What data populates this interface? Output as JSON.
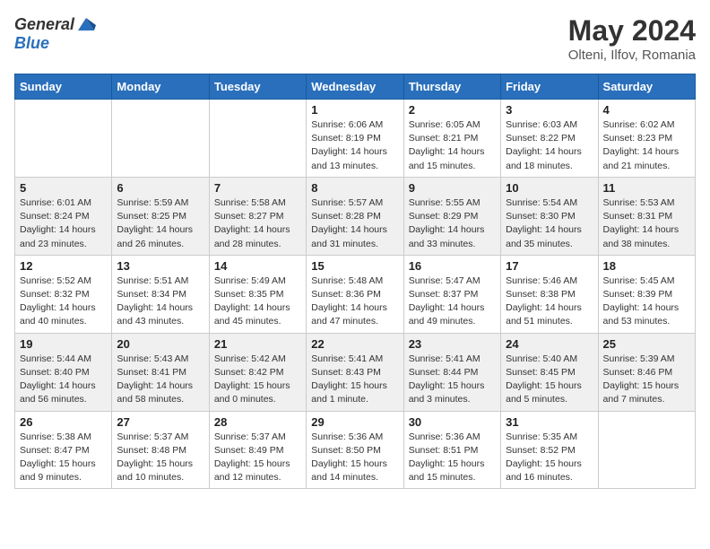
{
  "header": {
    "logo_general": "General",
    "logo_blue": "Blue",
    "month_title": "May 2024",
    "location": "Olteni, Ilfov, Romania"
  },
  "days_of_week": [
    "Sunday",
    "Monday",
    "Tuesday",
    "Wednesday",
    "Thursday",
    "Friday",
    "Saturday"
  ],
  "weeks": [
    {
      "row_shade": false,
      "days": [
        {
          "num": "",
          "info": ""
        },
        {
          "num": "",
          "info": ""
        },
        {
          "num": "",
          "info": ""
        },
        {
          "num": "1",
          "info": "Sunrise: 6:06 AM\nSunset: 8:19 PM\nDaylight: 14 hours\nand 13 minutes."
        },
        {
          "num": "2",
          "info": "Sunrise: 6:05 AM\nSunset: 8:21 PM\nDaylight: 14 hours\nand 15 minutes."
        },
        {
          "num": "3",
          "info": "Sunrise: 6:03 AM\nSunset: 8:22 PM\nDaylight: 14 hours\nand 18 minutes."
        },
        {
          "num": "4",
          "info": "Sunrise: 6:02 AM\nSunset: 8:23 PM\nDaylight: 14 hours\nand 21 minutes."
        }
      ]
    },
    {
      "row_shade": true,
      "days": [
        {
          "num": "5",
          "info": "Sunrise: 6:01 AM\nSunset: 8:24 PM\nDaylight: 14 hours\nand 23 minutes."
        },
        {
          "num": "6",
          "info": "Sunrise: 5:59 AM\nSunset: 8:25 PM\nDaylight: 14 hours\nand 26 minutes."
        },
        {
          "num": "7",
          "info": "Sunrise: 5:58 AM\nSunset: 8:27 PM\nDaylight: 14 hours\nand 28 minutes."
        },
        {
          "num": "8",
          "info": "Sunrise: 5:57 AM\nSunset: 8:28 PM\nDaylight: 14 hours\nand 31 minutes."
        },
        {
          "num": "9",
          "info": "Sunrise: 5:55 AM\nSunset: 8:29 PM\nDaylight: 14 hours\nand 33 minutes."
        },
        {
          "num": "10",
          "info": "Sunrise: 5:54 AM\nSunset: 8:30 PM\nDaylight: 14 hours\nand 35 minutes."
        },
        {
          "num": "11",
          "info": "Sunrise: 5:53 AM\nSunset: 8:31 PM\nDaylight: 14 hours\nand 38 minutes."
        }
      ]
    },
    {
      "row_shade": false,
      "days": [
        {
          "num": "12",
          "info": "Sunrise: 5:52 AM\nSunset: 8:32 PM\nDaylight: 14 hours\nand 40 minutes."
        },
        {
          "num": "13",
          "info": "Sunrise: 5:51 AM\nSunset: 8:34 PM\nDaylight: 14 hours\nand 43 minutes."
        },
        {
          "num": "14",
          "info": "Sunrise: 5:49 AM\nSunset: 8:35 PM\nDaylight: 14 hours\nand 45 minutes."
        },
        {
          "num": "15",
          "info": "Sunrise: 5:48 AM\nSunset: 8:36 PM\nDaylight: 14 hours\nand 47 minutes."
        },
        {
          "num": "16",
          "info": "Sunrise: 5:47 AM\nSunset: 8:37 PM\nDaylight: 14 hours\nand 49 minutes."
        },
        {
          "num": "17",
          "info": "Sunrise: 5:46 AM\nSunset: 8:38 PM\nDaylight: 14 hours\nand 51 minutes."
        },
        {
          "num": "18",
          "info": "Sunrise: 5:45 AM\nSunset: 8:39 PM\nDaylight: 14 hours\nand 53 minutes."
        }
      ]
    },
    {
      "row_shade": true,
      "days": [
        {
          "num": "19",
          "info": "Sunrise: 5:44 AM\nSunset: 8:40 PM\nDaylight: 14 hours\nand 56 minutes."
        },
        {
          "num": "20",
          "info": "Sunrise: 5:43 AM\nSunset: 8:41 PM\nDaylight: 14 hours\nand 58 minutes."
        },
        {
          "num": "21",
          "info": "Sunrise: 5:42 AM\nSunset: 8:42 PM\nDaylight: 15 hours\nand 0 minutes."
        },
        {
          "num": "22",
          "info": "Sunrise: 5:41 AM\nSunset: 8:43 PM\nDaylight: 15 hours\nand 1 minute."
        },
        {
          "num": "23",
          "info": "Sunrise: 5:41 AM\nSunset: 8:44 PM\nDaylight: 15 hours\nand 3 minutes."
        },
        {
          "num": "24",
          "info": "Sunrise: 5:40 AM\nSunset: 8:45 PM\nDaylight: 15 hours\nand 5 minutes."
        },
        {
          "num": "25",
          "info": "Sunrise: 5:39 AM\nSunset: 8:46 PM\nDaylight: 15 hours\nand 7 minutes."
        }
      ]
    },
    {
      "row_shade": false,
      "days": [
        {
          "num": "26",
          "info": "Sunrise: 5:38 AM\nSunset: 8:47 PM\nDaylight: 15 hours\nand 9 minutes."
        },
        {
          "num": "27",
          "info": "Sunrise: 5:37 AM\nSunset: 8:48 PM\nDaylight: 15 hours\nand 10 minutes."
        },
        {
          "num": "28",
          "info": "Sunrise: 5:37 AM\nSunset: 8:49 PM\nDaylight: 15 hours\nand 12 minutes."
        },
        {
          "num": "29",
          "info": "Sunrise: 5:36 AM\nSunset: 8:50 PM\nDaylight: 15 hours\nand 14 minutes."
        },
        {
          "num": "30",
          "info": "Sunrise: 5:36 AM\nSunset: 8:51 PM\nDaylight: 15 hours\nand 15 minutes."
        },
        {
          "num": "31",
          "info": "Sunrise: 5:35 AM\nSunset: 8:52 PM\nDaylight: 15 hours\nand 16 minutes."
        },
        {
          "num": "",
          "info": ""
        }
      ]
    }
  ]
}
